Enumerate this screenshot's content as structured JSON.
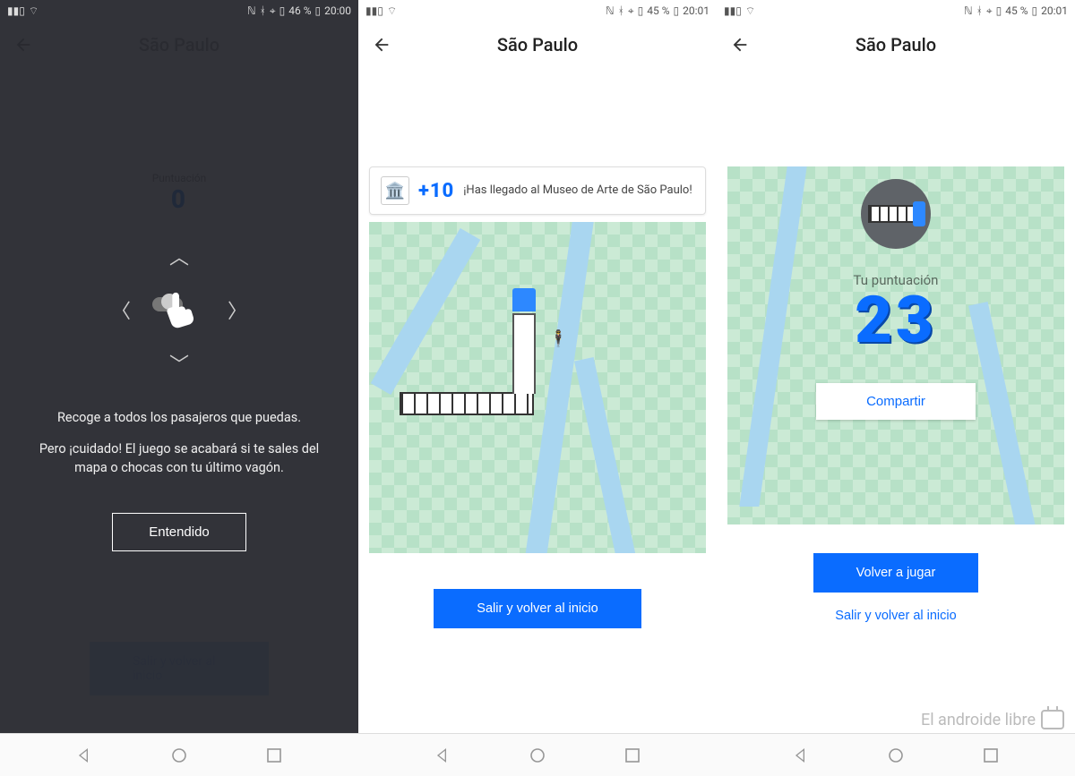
{
  "watermark": "El androide libre",
  "screen1": {
    "status": {
      "battery": "46 %",
      "time": "20:00"
    },
    "title": "São Paulo",
    "score_label": "Puntuación",
    "score_value": "0",
    "tutorial_line1": "Recoge a todos los pasajeros que puedas.",
    "tutorial_line2": "Pero ¡cuidado! El juego se acabará si te sales del mapa o chocas con tu último vagón.",
    "ok_button": "Entendido",
    "exit_button": "Salir y volver al inicio"
  },
  "screen2": {
    "status": {
      "battery": "45 %",
      "time": "20:01"
    },
    "title": "São Paulo",
    "toast_points": "+10",
    "toast_msg": "¡Has llegado al Museo de Arte de São Paulo!",
    "exit_button": "Salir y volver al inicio"
  },
  "screen3": {
    "status": {
      "battery": "45 %",
      "time": "20:01"
    },
    "title": "São Paulo",
    "result_label": "Tu puntuación",
    "result_score": "23",
    "share_button": "Compartir",
    "play_again_button": "Volver a jugar",
    "exit_button": "Salir y volver al inicio"
  }
}
